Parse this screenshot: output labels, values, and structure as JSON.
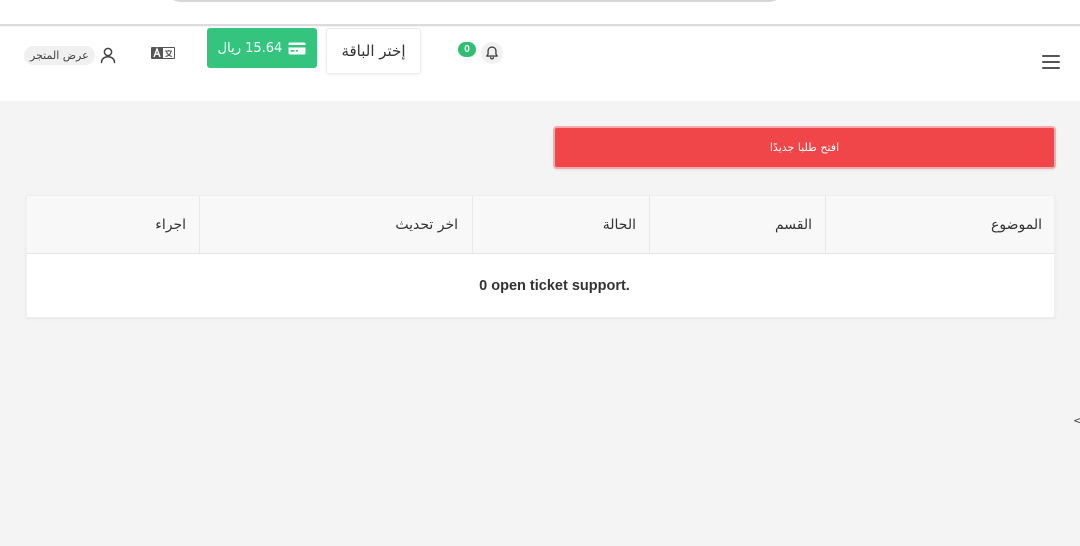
{
  "header": {
    "notifications_count": "0",
    "plan_label": "إختر الباقة",
    "balance_label": "15.64 ريال",
    "store_label": "عرض المتجر"
  },
  "actions": {
    "new_ticket_label": "افتح طلبا جديدًا"
  },
  "table": {
    "columns": [
      "الموضوع",
      "القسم",
      "الحالة",
      "اخر تحديث",
      "اجراء"
    ],
    "empty_message": "0 open ticket support."
  },
  "side": {
    "arrow_glyph": "<"
  },
  "colors": {
    "accent_green": "#35c47e",
    "danger_red": "#f04649",
    "page_background": "#f4f4f5"
  },
  "icons": [
    "menu-icon",
    "bell-icon",
    "card-icon",
    "translate-icon",
    "user-icon"
  ]
}
